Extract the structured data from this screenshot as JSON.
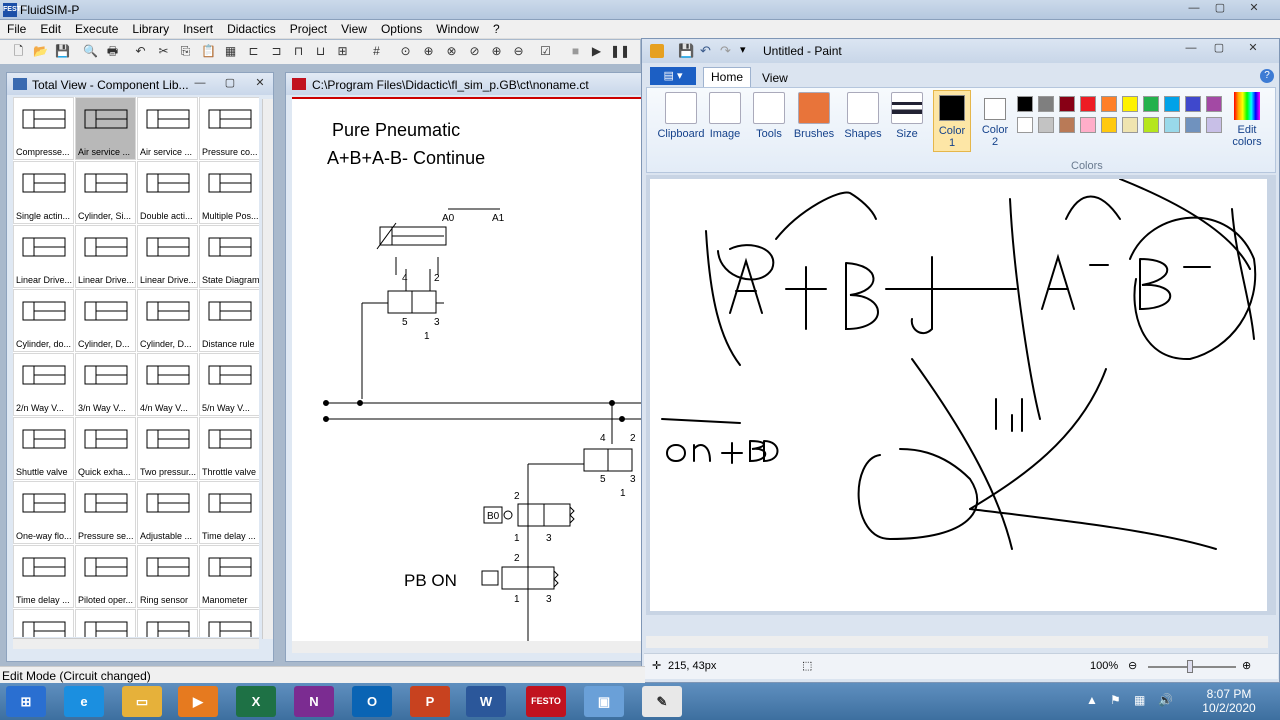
{
  "fluidsim": {
    "title": "FluidSIM-P",
    "logo": "FESTO",
    "menu": [
      "File",
      "Edit",
      "Execute",
      "Library",
      "Insert",
      "Didactics",
      "Project",
      "View",
      "Options",
      "Window",
      "?"
    ],
    "window_controls": [
      "—",
      "▢",
      "✕"
    ]
  },
  "library": {
    "title": "Total View - Component Lib...",
    "items": [
      {
        "label": "Compresse...",
        "icon": "compressor-icon"
      },
      {
        "label": "Air service ...",
        "icon": "air-service-unit-icon"
      },
      {
        "label": "Air service ...",
        "icon": "air-service-unit-detailed-icon"
      },
      {
        "label": "Pressure co...",
        "icon": "pressure-control-icon"
      },
      {
        "label": "Single actin...",
        "icon": "single-acting-cylinder-icon"
      },
      {
        "label": "Cylinder, Si...",
        "icon": "cylinder-single-icon"
      },
      {
        "label": "Double acti...",
        "icon": "double-acting-cylinder-icon"
      },
      {
        "label": "Multiple Pos...",
        "icon": "multi-position-cylinder-icon"
      },
      {
        "label": "Linear Drive...",
        "icon": "linear-drive-icon"
      },
      {
        "label": "Linear Drive...",
        "icon": "linear-drive-2-icon"
      },
      {
        "label": "Linear Drive...",
        "icon": "linear-drive-3-icon"
      },
      {
        "label": "State Diagram",
        "icon": "state-diagram-icon"
      },
      {
        "label": "Cylinder, do...",
        "icon": "cylinder-double-icon"
      },
      {
        "label": "Cylinder, D...",
        "icon": "cylinder-d-icon"
      },
      {
        "label": "Cylinder, D...",
        "icon": "cylinder-d2-icon"
      },
      {
        "label": "Distance rule",
        "icon": "distance-rule-icon"
      },
      {
        "label": "2/n Way V...",
        "icon": "valve-2n-icon"
      },
      {
        "label": "3/n Way V...",
        "icon": "valve-3n-icon"
      },
      {
        "label": "4/n Way V...",
        "icon": "valve-4n-icon"
      },
      {
        "label": "5/n Way V...",
        "icon": "valve-5n-icon"
      },
      {
        "label": "Shuttle valve",
        "icon": "shuttle-valve-icon"
      },
      {
        "label": "Quick exha...",
        "icon": "quick-exhaust-icon"
      },
      {
        "label": "Two pressur...",
        "icon": "two-pressure-valve-icon"
      },
      {
        "label": "Throttle valve",
        "icon": "throttle-valve-icon"
      },
      {
        "label": "One-way flo...",
        "icon": "one-way-flow-icon"
      },
      {
        "label": "Pressure se...",
        "icon": "pressure-sequence-icon"
      },
      {
        "label": "Adjustable ...",
        "icon": "adjustable-icon"
      },
      {
        "label": "Time delay ...",
        "icon": "time-delay-icon"
      },
      {
        "label": "Time delay ...",
        "icon": "time-delay-2-icon"
      },
      {
        "label": "Piloted oper...",
        "icon": "piloted-operated-icon"
      },
      {
        "label": "Ring sensor",
        "icon": "ring-sensor-icon"
      },
      {
        "label": "Manometer",
        "icon": "manometer-icon"
      },
      {
        "label": "",
        "icon": "component-icon"
      },
      {
        "label": "",
        "icon": "component-icon"
      },
      {
        "label": "",
        "icon": "component-icon"
      },
      {
        "label": "",
        "icon": "component-icon"
      }
    ]
  },
  "circuit": {
    "title": "C:\\Program Files\\Didactic\\fl_sim_p.GB\\ct\\noname.ct",
    "heading1": "Pure  Pneumatic",
    "heading2": "A+B+A-B-  Continue",
    "pb_label": "PB  ON",
    "a0": "A0",
    "a1": "A1",
    "b0": "B0",
    "port4": "4",
    "port2": "2",
    "port5": "5",
    "port3": "3",
    "port1": "1"
  },
  "status": {
    "text": "Edit Mode (Circuit changed)"
  },
  "paint": {
    "title": "Untitled - Paint",
    "file_tab": "▤ ▾",
    "tab_home": "Home",
    "tab_view": "View",
    "groups": [
      "Clipboard",
      "Image",
      "Tools",
      "Brushes",
      "Shapes",
      "Size",
      "Color\n1",
      "Color\n2",
      "Edit\ncolors"
    ],
    "color1": "Color",
    "color1b": "1",
    "color2": "Color",
    "color2b": "2",
    "edit1": "Edit",
    "edit2": "colors",
    "colors_label": "Colors",
    "palette": [
      "#000000",
      "#7f7f7f",
      "#880015",
      "#ed1c24",
      "#ff7f27",
      "#fff200",
      "#22b14c",
      "#00a2e8",
      "#3f48cc",
      "#a349a4",
      "#ffffff",
      "#c3c3c3",
      "#b97a57",
      "#ffaec9",
      "#ffc90e",
      "#efe4b0",
      "#b5e61d",
      "#99d9ea",
      "#7092be",
      "#c8bfe7"
    ],
    "coords": "215, 43px",
    "zoom": "100%"
  },
  "taskbar": {
    "clock_time": "8:07 PM",
    "clock_date": "10/2/2020",
    "apps": [
      {
        "name": "start",
        "label": "⊞",
        "color": "#2a6fd1"
      },
      {
        "name": "ie",
        "label": "e",
        "color": "#1b8fe0"
      },
      {
        "name": "explorer",
        "label": "▭",
        "color": "#e6b13a"
      },
      {
        "name": "media",
        "label": "▶",
        "color": "#e67a1f"
      },
      {
        "name": "excel",
        "label": "X",
        "color": "#1e7145"
      },
      {
        "name": "onenote",
        "label": "N",
        "color": "#7b2c91"
      },
      {
        "name": "outlook",
        "label": "O",
        "color": "#0a64b4"
      },
      {
        "name": "powerpoint",
        "label": "P",
        "color": "#c8421f"
      },
      {
        "name": "word",
        "label": "W",
        "color": "#2b579a"
      },
      {
        "name": "fluidsim",
        "label": "FESTO",
        "color": "#c1121f"
      },
      {
        "name": "computer",
        "label": "▣",
        "color": "#6aa0d8"
      },
      {
        "name": "paint",
        "label": "✎",
        "color": "#e8e8e8"
      }
    ],
    "tray": [
      "▲",
      "⚑",
      "▦",
      "🔊"
    ]
  }
}
